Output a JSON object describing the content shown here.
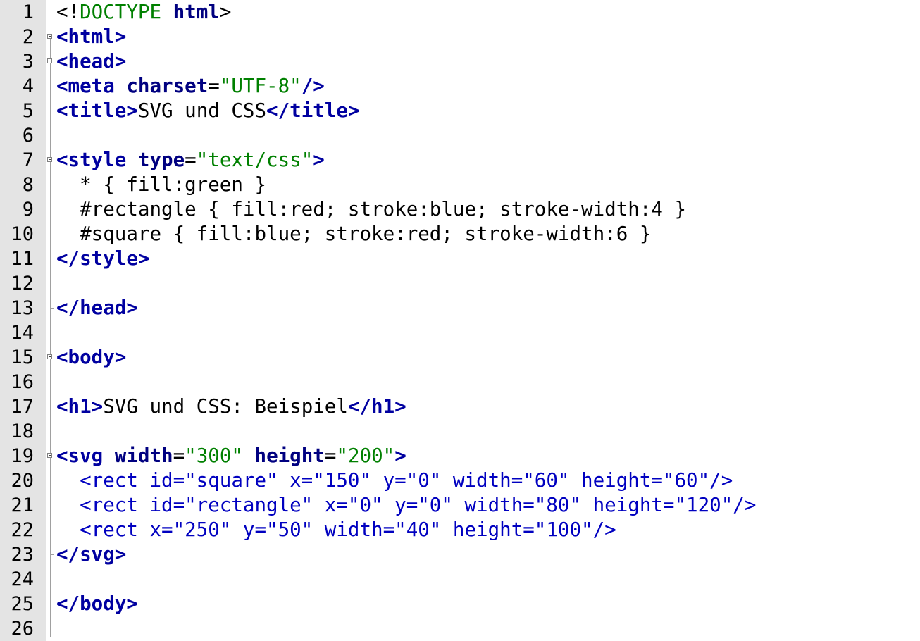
{
  "lines": [
    {
      "n": "1",
      "parts": [
        [
          "plain",
          "<!"
        ],
        [
          "doctype-kw",
          "DOCTYPE"
        ],
        [
          "plain",
          " "
        ],
        [
          "doctype-html",
          "html"
        ],
        [
          "plain",
          ">"
        ]
      ]
    },
    {
      "n": "2",
      "parts": [
        [
          "tag",
          "<html>"
        ]
      ]
    },
    {
      "n": "3",
      "parts": [
        [
          "tag",
          "<head>"
        ]
      ]
    },
    {
      "n": "4",
      "parts": [
        [
          "tag",
          "<meta"
        ],
        [
          "plain",
          " "
        ],
        [
          "attr",
          "charset"
        ],
        [
          "plain",
          "="
        ],
        [
          "val",
          "\"UTF-8\""
        ],
        [
          "tag",
          "/>"
        ]
      ]
    },
    {
      "n": "5",
      "parts": [
        [
          "tag",
          "<title>"
        ],
        [
          "plain",
          "SVG und CSS"
        ],
        [
          "tag",
          "</title>"
        ]
      ]
    },
    {
      "n": "6",
      "parts": []
    },
    {
      "n": "7",
      "parts": [
        [
          "tag",
          "<style"
        ],
        [
          "plain",
          " "
        ],
        [
          "attr",
          "type"
        ],
        [
          "plain",
          "="
        ],
        [
          "val",
          "\"text/css\""
        ],
        [
          "tag",
          ">"
        ]
      ]
    },
    {
      "n": "8",
      "parts": [
        [
          "plain",
          "  * { fill:green }"
        ]
      ]
    },
    {
      "n": "9",
      "parts": [
        [
          "plain",
          "  #rectangle { fill:red; stroke:blue; stroke-width:4 }"
        ]
      ]
    },
    {
      "n": "10",
      "parts": [
        [
          "plain",
          "  #square { fill:blue; stroke:red; stroke-width:6 }"
        ]
      ]
    },
    {
      "n": "11",
      "parts": [
        [
          "tag",
          "</style>"
        ]
      ]
    },
    {
      "n": "12",
      "parts": []
    },
    {
      "n": "13",
      "parts": [
        [
          "tag",
          "</head>"
        ]
      ]
    },
    {
      "n": "14",
      "parts": []
    },
    {
      "n": "15",
      "parts": [
        [
          "tag",
          "<body>"
        ]
      ]
    },
    {
      "n": "16",
      "parts": []
    },
    {
      "n": "17",
      "parts": [
        [
          "tag",
          "<h1>"
        ],
        [
          "plain",
          "SVG und CSS: Beispiel"
        ],
        [
          "tag",
          "</h1>"
        ]
      ]
    },
    {
      "n": "18",
      "parts": []
    },
    {
      "n": "19",
      "parts": [
        [
          "tag",
          "<svg"
        ],
        [
          "plain",
          " "
        ],
        [
          "attr",
          "width"
        ],
        [
          "plain",
          "="
        ],
        [
          "val",
          "\"300\""
        ],
        [
          "plain",
          " "
        ],
        [
          "attr",
          "height"
        ],
        [
          "plain",
          "="
        ],
        [
          "val",
          "\"200\""
        ],
        [
          "tag",
          ">"
        ]
      ]
    },
    {
      "n": "20",
      "parts": [
        [
          "svgtext",
          "  <rect id=\"square\" x=\"150\" y=\"0\" width=\"60\" height=\"60\"/>"
        ]
      ]
    },
    {
      "n": "21",
      "parts": [
        [
          "svgtext",
          "  <rect id=\"rectangle\" x=\"0\" y=\"0\" width=\"80\" height=\"120\"/>"
        ]
      ]
    },
    {
      "n": "22",
      "parts": [
        [
          "svgtext",
          "  <rect x=\"250\" y=\"50\" width=\"40\" height=\"100\"/>"
        ]
      ]
    },
    {
      "n": "23",
      "parts": [
        [
          "tag",
          "</svg>"
        ]
      ]
    },
    {
      "n": "24",
      "parts": []
    },
    {
      "n": "25",
      "parts": [
        [
          "tag",
          "</body>"
        ]
      ]
    },
    {
      "n": "26",
      "parts": []
    }
  ],
  "folds": [
    "2",
    "3",
    "7",
    "15",
    "19"
  ],
  "colors": {
    "gutter": "#e4e4e4",
    "tag": "#0000a0",
    "attribute": "#000080",
    "value": "#008000",
    "text": "#000000"
  }
}
